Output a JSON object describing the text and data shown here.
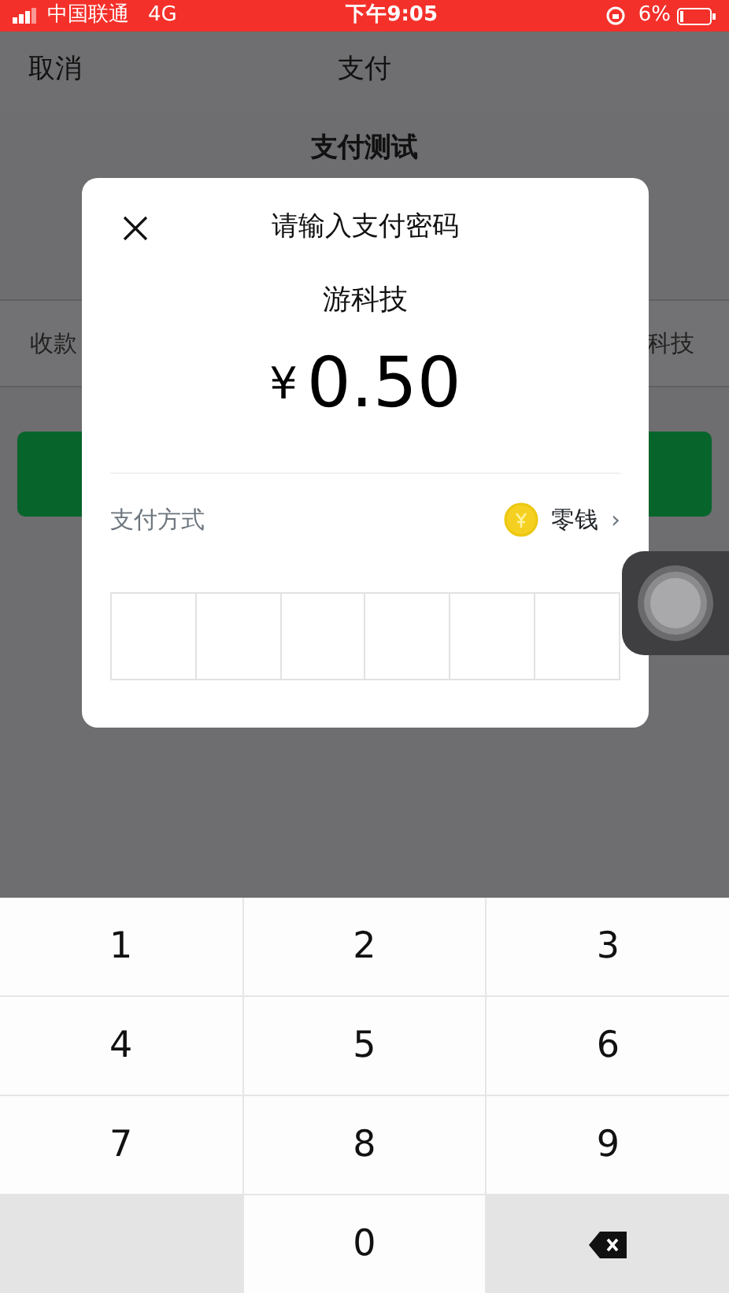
{
  "status_bar": {
    "carrier": "中国联通",
    "network": "4G",
    "time": "下午9:05",
    "battery_text": "6%"
  },
  "nav": {
    "cancel": "取消",
    "title": "支付"
  },
  "page": {
    "title": "支付测试",
    "payee_label": "收款",
    "payee_value": "科技"
  },
  "dialog": {
    "title": "请输入支付密码",
    "merchant": "游科技",
    "currency": "¥",
    "amount": "0.50",
    "method_label": "支付方式",
    "method_value": "零钱",
    "chevron": "›",
    "pin_boxes": [
      {
        "filled": false
      },
      {
        "filled": false
      },
      {
        "filled": false
      },
      {
        "filled": false
      },
      {
        "filled": false
      },
      {
        "filled": false
      }
    ]
  },
  "keypad": [
    {
      "kind": "digit",
      "label": "1"
    },
    {
      "kind": "digit",
      "label": "2"
    },
    {
      "kind": "digit",
      "label": "3"
    },
    {
      "kind": "digit",
      "label": "4"
    },
    {
      "kind": "digit",
      "label": "5"
    },
    {
      "kind": "digit",
      "label": "6"
    },
    {
      "kind": "digit",
      "label": "7"
    },
    {
      "kind": "digit",
      "label": "8"
    },
    {
      "kind": "digit",
      "label": "9"
    },
    {
      "kind": "blank"
    },
    {
      "kind": "digit",
      "label": "0"
    },
    {
      "kind": "backspace"
    }
  ]
}
